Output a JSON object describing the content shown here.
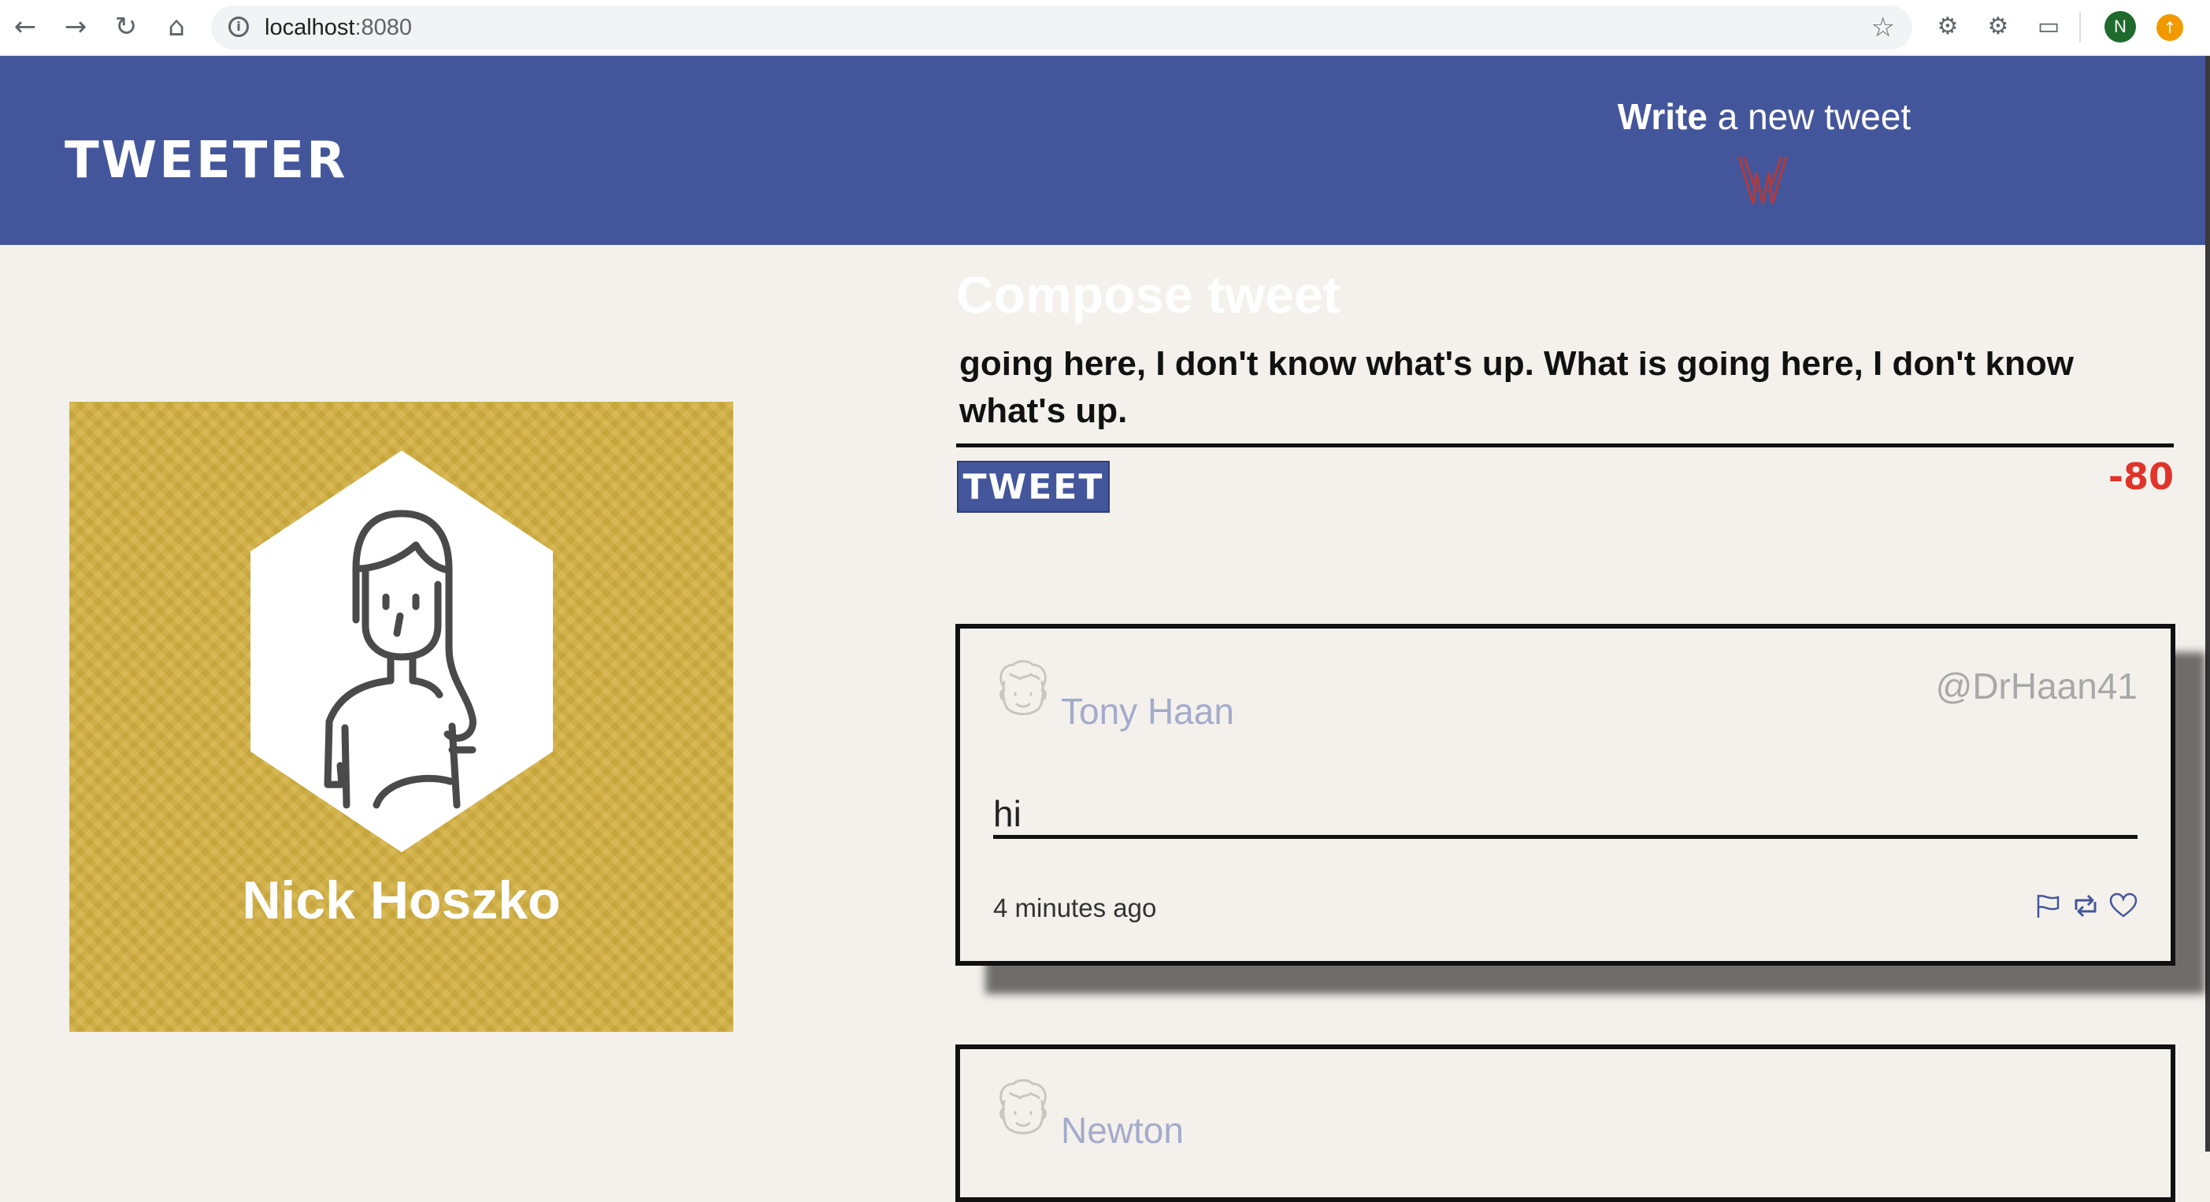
{
  "browser": {
    "url_host": "localhost",
    "url_port": ":8080"
  },
  "header": {
    "logo": "TWEETER",
    "write_bold": "Write",
    "write_rest": " a new tweet"
  },
  "profile": {
    "name": "Nick Hoszko",
    "card_color": "#d3b040"
  },
  "compose": {
    "title": "Compose tweet",
    "text": "going here, I don't know what's up. What is going here, I don't know what's up.",
    "button_label": "TWEET",
    "counter": "-80"
  },
  "tweets": [
    {
      "name": "Tony Haan",
      "handle": "@DrHaan41",
      "body": "hi",
      "time": "4 minutes ago"
    },
    {
      "name": "Newton"
    }
  ],
  "colors": {
    "header_bg": "#44569b",
    "page_bg": "#f4f1ec",
    "counter_over": "#e0342b"
  }
}
